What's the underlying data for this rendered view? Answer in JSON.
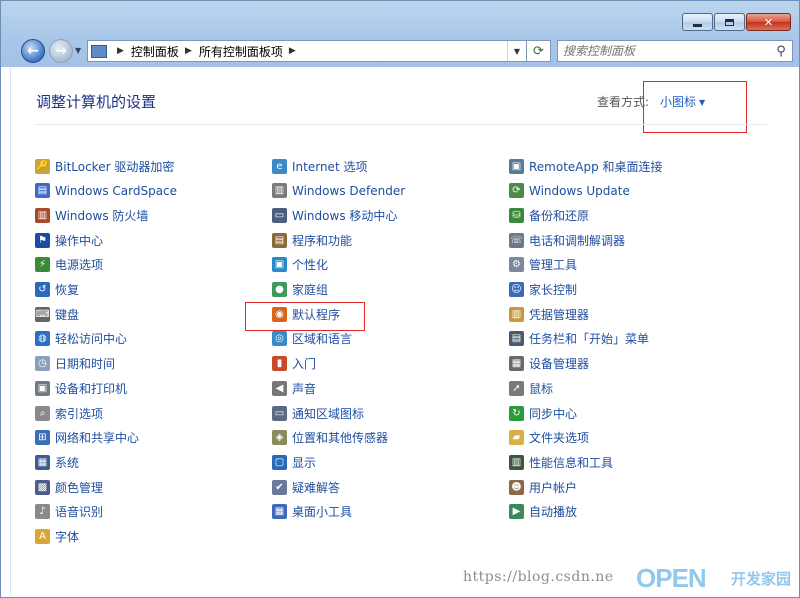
{
  "window": {
    "caption_buttons": [
      "minimize",
      "maximize",
      "close"
    ]
  },
  "address_bar": {
    "segments": [
      "控制面板",
      "所有控制面板项"
    ]
  },
  "search": {
    "placeholder": "搜索控制面板"
  },
  "header": {
    "title": "调整计算机的设置",
    "view_label": "查看方式:",
    "view_value": "小图标"
  },
  "columns": [
    [
      {
        "label": "BitLocker 驱动器加密",
        "icon": "bitlocker-icon"
      },
      {
        "label": "Windows CardSpace",
        "icon": "cardspace-icon"
      },
      {
        "label": "Windows 防火墙",
        "icon": "firewall-icon"
      },
      {
        "label": "操作中心",
        "icon": "action-center-flag-icon"
      },
      {
        "label": "电源选项",
        "icon": "power-options-icon"
      },
      {
        "label": "恢复",
        "icon": "recovery-icon"
      },
      {
        "label": "键盘",
        "icon": "keyboard-icon"
      },
      {
        "label": "轻松访问中心",
        "icon": "ease-of-access-icon"
      },
      {
        "label": "日期和时间",
        "icon": "date-time-icon"
      },
      {
        "label": "设备和打印机",
        "icon": "devices-printers-icon"
      },
      {
        "label": "索引选项",
        "icon": "indexing-icon"
      },
      {
        "label": "网络和共享中心",
        "icon": "network-sharing-icon"
      },
      {
        "label": "系统",
        "icon": "system-icon"
      },
      {
        "label": "颜色管理",
        "icon": "color-management-icon"
      },
      {
        "label": "语音识别",
        "icon": "speech-recognition-icon"
      },
      {
        "label": "字体",
        "icon": "fonts-icon"
      }
    ],
    [
      {
        "label": "Internet 选项",
        "icon": "internet-options-icon"
      },
      {
        "label": "Windows Defender",
        "icon": "defender-icon"
      },
      {
        "label": "Windows 移动中心",
        "icon": "mobility-center-icon"
      },
      {
        "label": "程序和功能",
        "icon": "programs-features-icon"
      },
      {
        "label": "个性化",
        "icon": "personalization-icon"
      },
      {
        "label": "家庭组",
        "icon": "homegroup-icon"
      },
      {
        "label": "默认程序",
        "icon": "default-programs-icon"
      },
      {
        "label": "区域和语言",
        "icon": "region-language-icon"
      },
      {
        "label": "入门",
        "icon": "getting-started-icon"
      },
      {
        "label": "声音",
        "icon": "sound-icon"
      },
      {
        "label": "通知区域图标",
        "icon": "notification-icons-icon"
      },
      {
        "label": "位置和其他传感器",
        "icon": "location-sensors-icon"
      },
      {
        "label": "显示",
        "icon": "display-icon"
      },
      {
        "label": "疑难解答",
        "icon": "troubleshooting-icon"
      },
      {
        "label": "桌面小工具",
        "icon": "gadgets-icon"
      }
    ],
    [
      {
        "label": "RemoteApp 和桌面连接",
        "icon": "remoteapp-icon"
      },
      {
        "label": "Windows Update",
        "icon": "windows-update-icon"
      },
      {
        "label": "备份和还原",
        "icon": "backup-restore-icon"
      },
      {
        "label": "电话和调制解调器",
        "icon": "phone-modem-icon"
      },
      {
        "label": "管理工具",
        "icon": "admin-tools-icon"
      },
      {
        "label": "家长控制",
        "icon": "parental-controls-icon"
      },
      {
        "label": "凭据管理器",
        "icon": "credential-manager-icon"
      },
      {
        "label": "任务栏和「开始」菜单",
        "icon": "taskbar-start-menu-icon"
      },
      {
        "label": "设备管理器",
        "icon": "device-manager-icon"
      },
      {
        "label": "鼠标",
        "icon": "mouse-icon"
      },
      {
        "label": "同步中心",
        "icon": "sync-center-icon"
      },
      {
        "label": "文件夹选项",
        "icon": "folder-options-icon"
      },
      {
        "label": "性能信息和工具",
        "icon": "performance-icon"
      },
      {
        "label": "用户帐户",
        "icon": "user-accounts-icon"
      },
      {
        "label": "自动播放",
        "icon": "autoplay-icon"
      }
    ]
  ],
  "colors": {
    "link": "#1f4ea1",
    "title": "#1e3287",
    "highlight": "#e02a2a"
  },
  "watermark": {
    "url": "https://blog.csdn.ne",
    "logo": "OPEN",
    "sub": "开发家园"
  }
}
